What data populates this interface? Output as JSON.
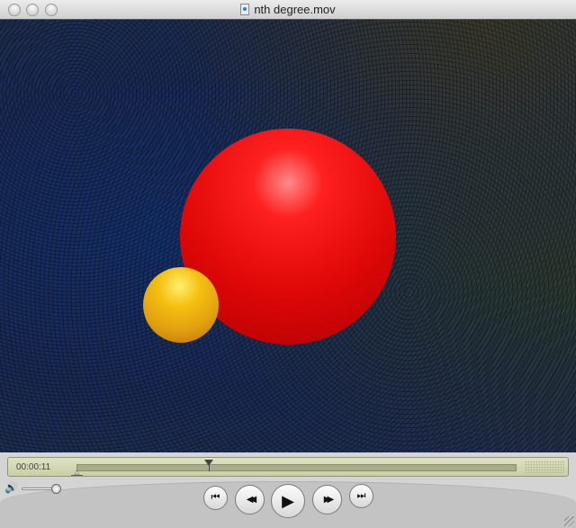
{
  "window": {
    "title": "nth degree.mov",
    "icon": "quicktime-document-icon"
  },
  "playback": {
    "current_time": "00:00:11",
    "progress_fraction": 0.3,
    "volume_fraction": 1.0,
    "in_point_fraction": 0.0
  },
  "controls": {
    "buttons": [
      {
        "name": "go-to-start",
        "icon": "skip-back-icon",
        "glyph": "⏮"
      },
      {
        "name": "rewind",
        "icon": "rewind-icon",
        "glyph": "◀◀"
      },
      {
        "name": "play",
        "icon": "play-icon",
        "glyph": "▶"
      },
      {
        "name": "fast-forward",
        "icon": "fast-forward-icon",
        "glyph": "▶▶"
      },
      {
        "name": "go-to-end",
        "icon": "skip-forward-icon",
        "glyph": "⏭"
      }
    ],
    "volume_icon": "🔊"
  }
}
